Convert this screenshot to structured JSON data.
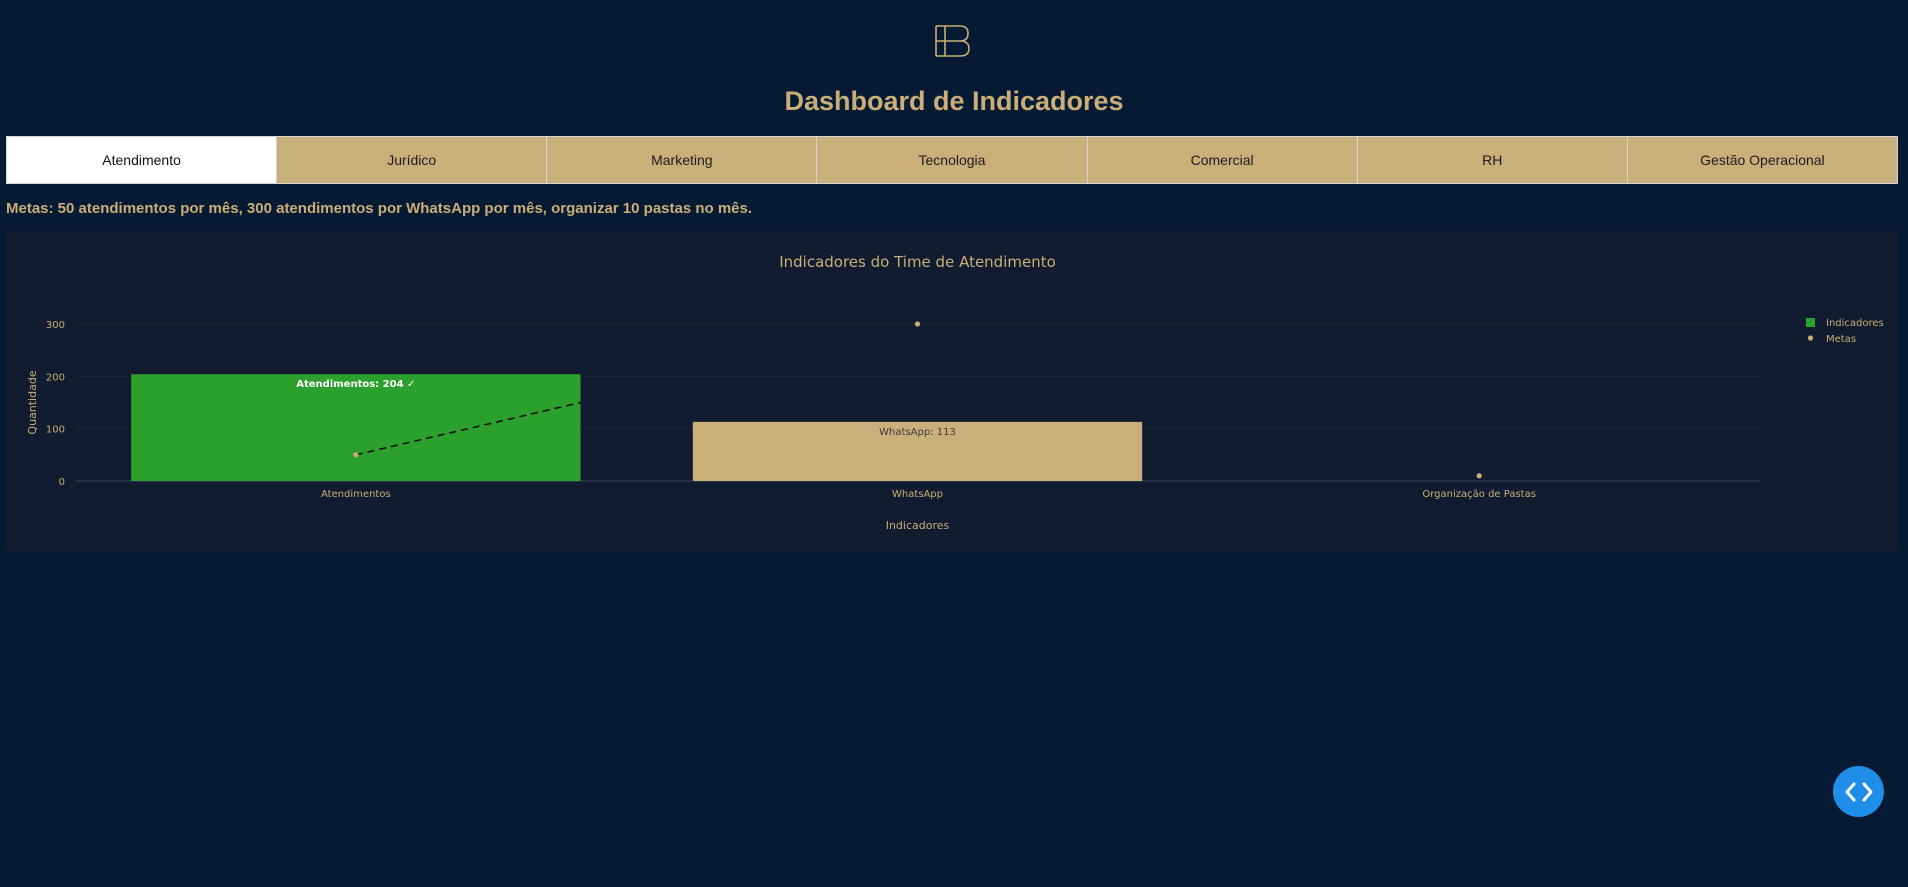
{
  "header": {
    "logo_icon": "eb-monogram-icon",
    "title": "Dashboard de Indicadores"
  },
  "tabs": [
    {
      "label": "Atendimento",
      "active": true
    },
    {
      "label": "Jurídico",
      "active": false
    },
    {
      "label": "Marketing",
      "active": false
    },
    {
      "label": "Tecnologia",
      "active": false
    },
    {
      "label": "Comercial",
      "active": false
    },
    {
      "label": "RH",
      "active": false
    },
    {
      "label": "Gestão Operacional",
      "active": false
    }
  ],
  "goals_text": "Metas: 50 atendimentos por mês, 300 atendimentos por WhatsApp por mês, organizar 10 pastas no mês.",
  "colors": {
    "background": "#071a33",
    "gold": "#c9ae78",
    "green": "#2ca02c",
    "tab_bg": "#c9b07a",
    "code_button": "#1e8ee8"
  },
  "chart_data": {
    "type": "bar",
    "title": "Indicadores do Time de Atendimento",
    "xlabel": "Indicadores",
    "ylabel": "Quantidade",
    "ylim": [
      0,
      300
    ],
    "yticks": [
      0,
      100,
      200,
      300
    ],
    "categories": [
      "Atendimentos",
      "WhatsApp",
      "Organização de Pastas"
    ],
    "series": [
      {
        "name": "Indicadores",
        "type": "bar",
        "values": [
          204,
          113,
          null
        ],
        "colors": [
          "#2ca02c",
          "#c9b07a",
          "#c9b07a"
        ],
        "labels": [
          "Atendimentos: 204 ✓",
          "WhatsApp: 113",
          ""
        ]
      },
      {
        "name": "Metas",
        "type": "scatter",
        "values": [
          50,
          300,
          10
        ],
        "color": "#c9ae78"
      }
    ],
    "trend_line": {
      "from_category": "Atendimentos",
      "from_value": 50,
      "to_value": 150
    },
    "legend": "top-right",
    "grid": true
  },
  "code_button": {
    "icon": "code-brackets-icon"
  }
}
